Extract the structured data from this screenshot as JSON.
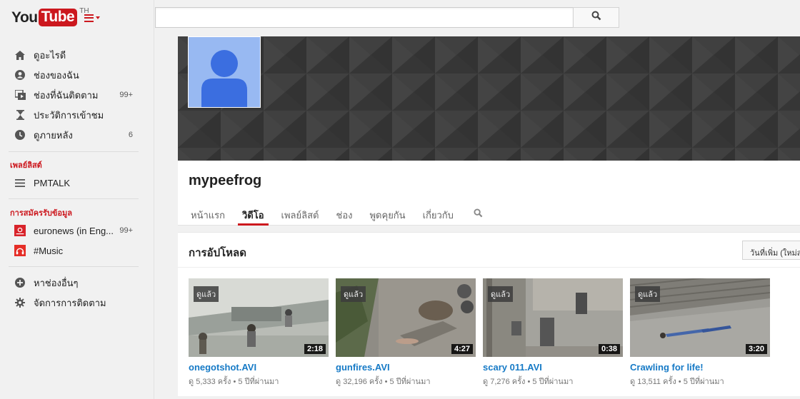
{
  "logo": {
    "you": "You",
    "tube": "Tube",
    "region": "TH"
  },
  "nav_main": [
    {
      "label": "ดูอะไรดี",
      "icon": "home-icon",
      "count": ""
    },
    {
      "label": "ช่องของฉัน",
      "icon": "user-icon",
      "count": ""
    },
    {
      "label": "ช่องที่ฉันติดตาม",
      "icon": "subscriptions-icon",
      "count": "99+"
    },
    {
      "label": "ประวัติการเข้าชม",
      "icon": "hourglass-icon",
      "count": ""
    },
    {
      "label": "ดูภายหลัง",
      "icon": "clock-icon",
      "count": "6"
    }
  ],
  "playlists_title": "เพลย์ลิสต์",
  "playlists": [
    {
      "label": "PMTALK",
      "icon": "playlist-icon"
    }
  ],
  "subscriptions_title": "การสมัครรับข้อมูล",
  "subscriptions": [
    {
      "label": "euronews (in Eng...",
      "count": "99+",
      "icon": "euronews-icon"
    },
    {
      "label": "#Music",
      "count": "",
      "icon": "music-icon"
    }
  ],
  "nav_bottom": [
    {
      "label": "หาช่องอื่นๆ",
      "icon": "plus-circle-icon"
    },
    {
      "label": "จัดการการติดตาม",
      "icon": "gear-icon"
    }
  ],
  "search": {
    "placeholder": "",
    "value": ""
  },
  "channel": {
    "name": "mypeefrog",
    "tabs": [
      "หน้าแรก",
      "วิดีโอ",
      "เพลย์ลิสต์",
      "ช่อง",
      "พูดคุยกัน",
      "เกี่ยวกับ"
    ],
    "active_tab": "วิดีโอ"
  },
  "uploads": {
    "title": "การอัปโหลด",
    "sort_label": "วันที่เพิ่ม (ใหม่สุด)",
    "videos": [
      {
        "title": "onegotshot.AVI",
        "views": "ดู 5,333 ครั้ง",
        "age": "5 ปีที่ผ่านมา",
        "duration": "2:18",
        "watched": "ดูแล้ว"
      },
      {
        "title": "gunfires.AVI",
        "views": "ดู 32,196 ครั้ง",
        "age": "5 ปีที่ผ่านมา",
        "duration": "4:27",
        "watched": "ดูแล้ว"
      },
      {
        "title": "scary 011.AVI",
        "views": "ดู 7,276 ครั้ง",
        "age": "5 ปีที่ผ่านมา",
        "duration": "0:38",
        "watched": "ดูแล้ว"
      },
      {
        "title": "Crawling for life!",
        "views": "ดู 13,511 ครั้ง",
        "age": "5 ปีที่ผ่านมา",
        "duration": "3:20",
        "watched": "ดูแล้ว"
      }
    ]
  },
  "colors": {
    "accent": "#cc181e",
    "link": "#167ac6",
    "avatar": "#98b9f2",
    "avatar_figure": "#3b6ee0"
  }
}
